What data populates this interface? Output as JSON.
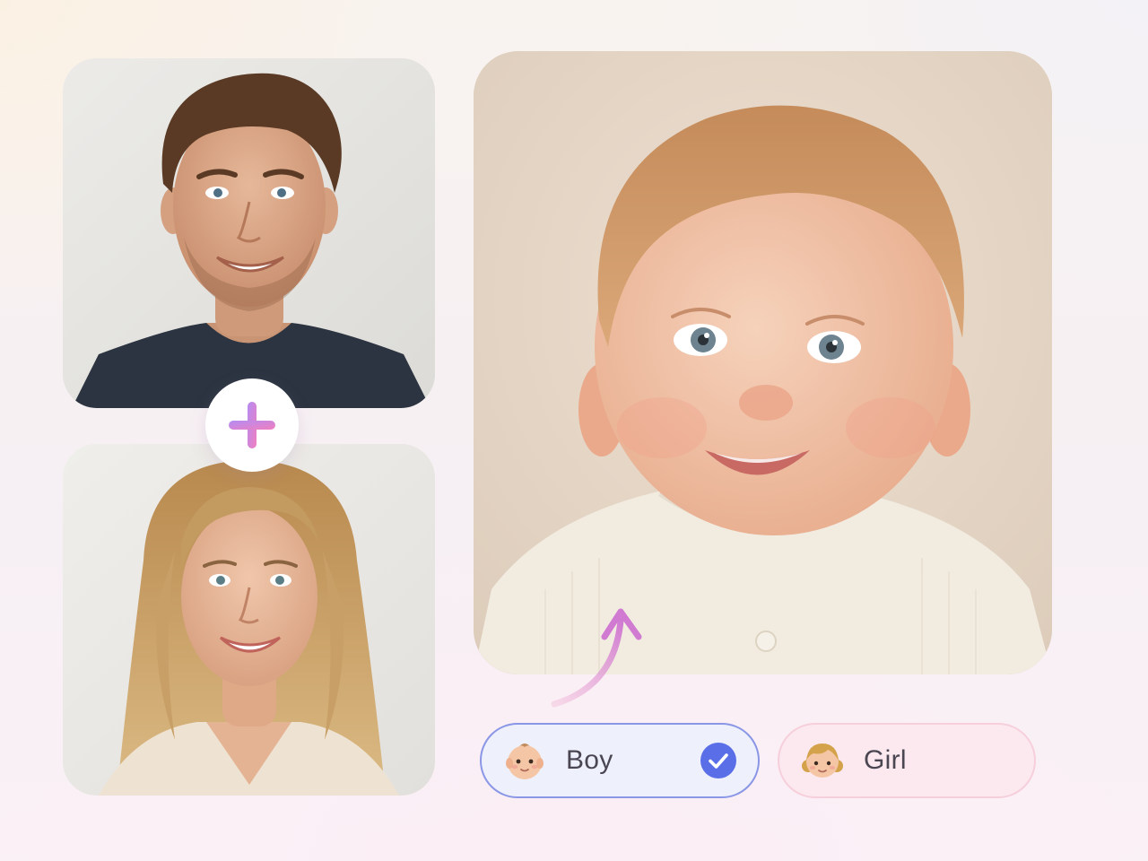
{
  "photos": {
    "father": {
      "icon": "man-portrait-photo"
    },
    "mother": {
      "icon": "woman-portrait-photo"
    },
    "baby": {
      "icon": "baby-portrait-photo"
    }
  },
  "combine_icon": "plus-icon",
  "result_arrow_icon": "curved-arrow-icon",
  "gender_options": [
    {
      "label": "Boy",
      "icon": "baby-boy-emoji",
      "selected": true
    },
    {
      "label": "Girl",
      "icon": "girl-emoji",
      "selected": false
    }
  ],
  "colors": {
    "selected_border": "#8a96e6",
    "checkmark": "#5a6ee8",
    "girl_background": "#fbe9ef",
    "plus_gradient_start": "#b58cf2",
    "plus_gradient_end": "#f07fc0"
  }
}
